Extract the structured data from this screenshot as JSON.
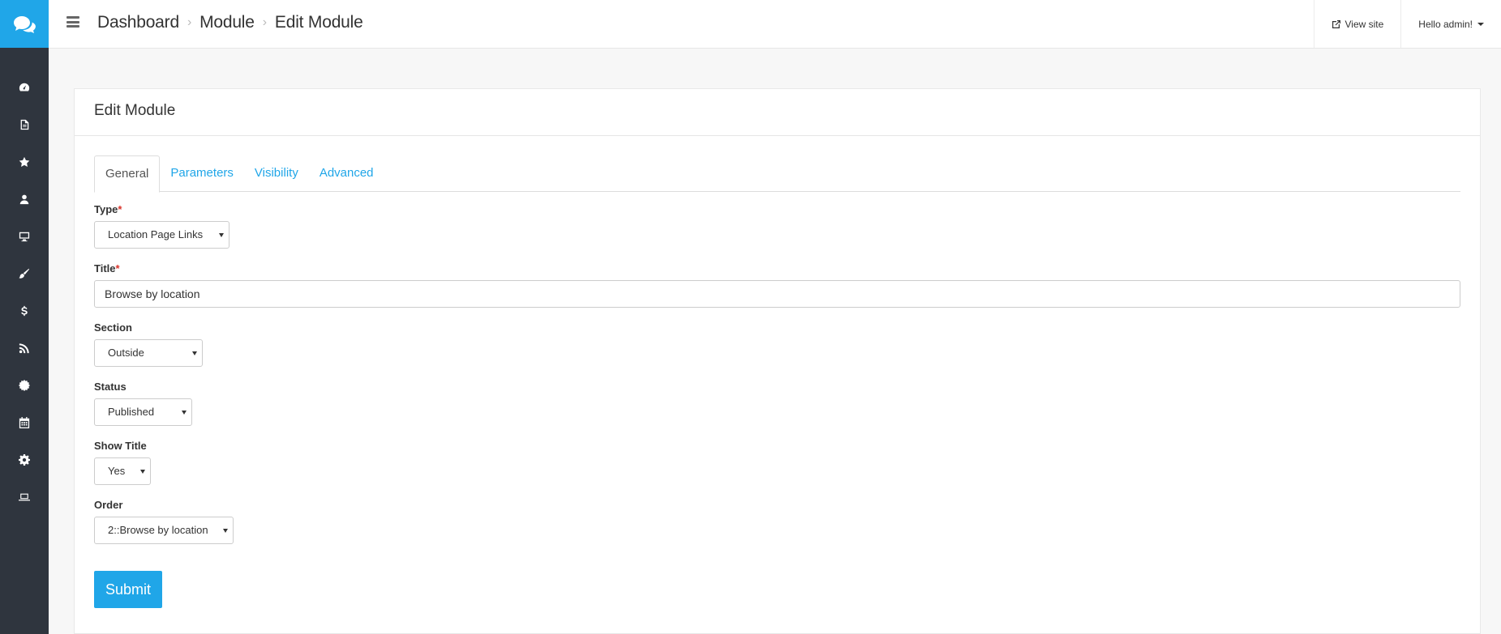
{
  "topbar": {
    "breadcrumb": [
      "Dashboard",
      "Module",
      "Edit Module"
    ],
    "view_site": "View site",
    "user_greeting": "Hello admin!"
  },
  "sidebar": {
    "logo_icon": "chat-bubbles-icon",
    "items": [
      {
        "icon": "dashboard-icon"
      },
      {
        "icon": "file-icon"
      },
      {
        "icon": "star-icon"
      },
      {
        "icon": "user-icon"
      },
      {
        "icon": "desktop-icon"
      },
      {
        "icon": "paint-brush-icon"
      },
      {
        "icon": "dollar-icon"
      },
      {
        "icon": "rss-icon"
      },
      {
        "icon": "certificate-icon"
      },
      {
        "icon": "calendar-icon"
      },
      {
        "icon": "gear-icon"
      },
      {
        "icon": "laptop-icon"
      }
    ]
  },
  "panel": {
    "title": "Edit Module",
    "tabs": [
      {
        "label": "General",
        "active": true
      },
      {
        "label": "Parameters",
        "active": false
      },
      {
        "label": "Visibility",
        "active": false
      },
      {
        "label": "Advanced",
        "active": false
      }
    ]
  },
  "form": {
    "type": {
      "label": "Type",
      "required_mark": "*",
      "value": "Location Page Links"
    },
    "title": {
      "label": "Title",
      "required_mark": "*",
      "value": "Browse by location"
    },
    "section": {
      "label": "Section",
      "value": "Outside"
    },
    "status": {
      "label": "Status",
      "value": "Published"
    },
    "show_title": {
      "label": "Show Title",
      "value": "Yes"
    },
    "order": {
      "label": "Order",
      "value": "2::Browse by location"
    },
    "submit_label": "Submit"
  },
  "colors": {
    "brand": "#20a6e8",
    "sidebar_bg": "#2f353e",
    "required": "#d9342b"
  }
}
